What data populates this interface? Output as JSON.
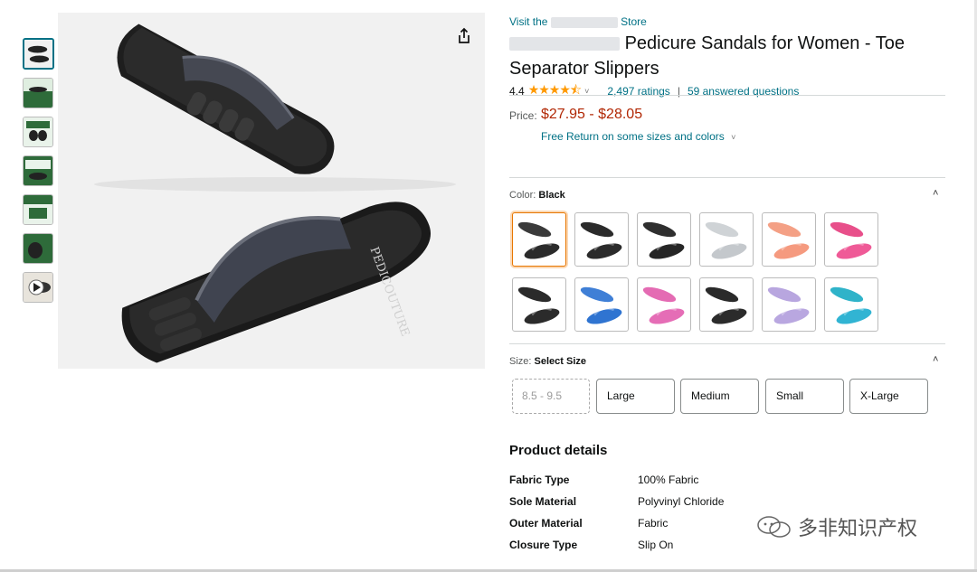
{
  "store": {
    "prefix": "Visit the",
    "suffix": "Store"
  },
  "product": {
    "title": "Pedicure Sandals for Women - Toe Separator Slippers"
  },
  "rating": {
    "value": "4.4",
    "stars": "★★★★⯪",
    "count": "2,497 ratings",
    "separator": "|",
    "questions": "59 answered questions"
  },
  "price": {
    "label": "Price:",
    "range": "$27.95 - $28.05",
    "returns": "Free Return on some sizes and colors"
  },
  "color": {
    "label": "Color:",
    "selected": "Black",
    "swatches": [
      {
        "top": "#3a3a3a",
        "bottom": "#2b2b2b"
      },
      {
        "top": "#2b2b2b",
        "bottom": "#2b2b2b"
      },
      {
        "top": "#2f2f2f",
        "bottom": "#262626"
      },
      {
        "top": "#cfd3d6",
        "bottom": "#c4c8cc"
      },
      {
        "top": "#f4a085",
        "bottom": "#f59a7f"
      },
      {
        "top": "#e84f8a",
        "bottom": "#ef5a97"
      },
      {
        "top": "#2a2a2a",
        "bottom": "#2b2b2b"
      },
      {
        "top": "#3f7fd6",
        "bottom": "#2f74d1"
      },
      {
        "top": "#e46bb3",
        "bottom": "#e56db6"
      },
      {
        "top": "#2a2a2a",
        "bottom": "#2b2b2b"
      },
      {
        "top": "#b8a6df",
        "bottom": "#b9a7e0"
      },
      {
        "top": "#2fb3c9",
        "bottom": "#31b4d3"
      }
    ]
  },
  "size": {
    "label": "Size:",
    "selected": "Select Size",
    "options": [
      "8.5 - 9.5",
      "Large",
      "Medium",
      "Small",
      "X-Large"
    ]
  },
  "details": {
    "title": "Product details",
    "rows": [
      {
        "key": "Fabric Type",
        "value": "100% Fabric"
      },
      {
        "key": "Sole Material",
        "value": "Polyvinyl Chloride"
      },
      {
        "key": "Outer Material",
        "value": "Fabric"
      },
      {
        "key": "Closure Type",
        "value": "Slip On"
      }
    ]
  },
  "watermark": {
    "text": "多非知识产权"
  },
  "icons": {
    "share": "share-icon",
    "caret": "chevron-up-icon",
    "dropdown": "chevron-down-icon"
  }
}
